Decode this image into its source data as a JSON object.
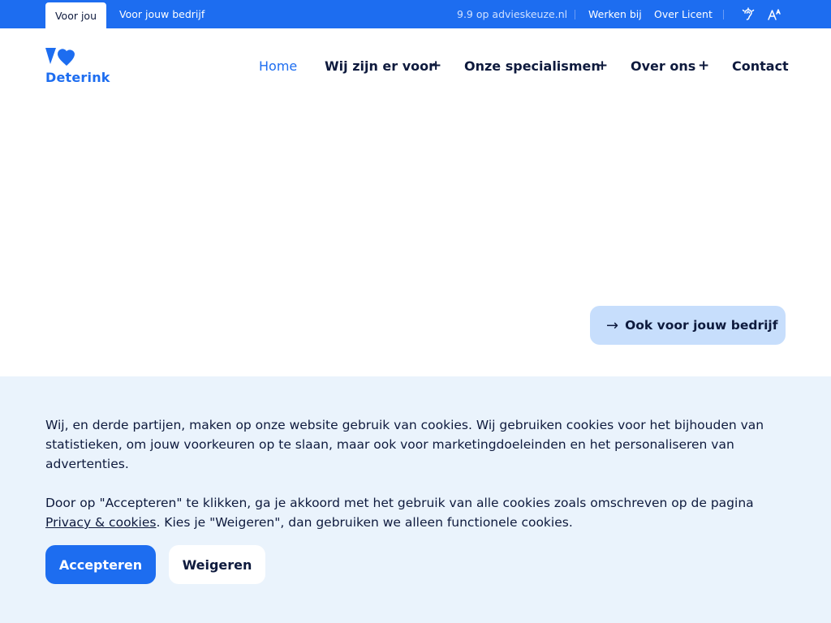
{
  "topbar": {
    "tab_active": "Voor jou",
    "tab_business": "Voor jouw bedrijf",
    "rating": "9.9 op advieskeuze.nl",
    "careers": "Werken bij",
    "licent": "Over Licent",
    "icons": [
      "hearing-icon",
      "text-size-icon"
    ]
  },
  "logo": {
    "text": "Deterink"
  },
  "nav": {
    "home": "Home",
    "we_are_there": "Wij zijn er voor",
    "specialisms": "Onze specialismen",
    "about": "Over ons",
    "contact": "Contact",
    "plus": "+"
  },
  "cta": {
    "arrow": "→",
    "label": "Ook voor jouw bedrijf"
  },
  "cookie": {
    "text1": "Wij, en derde partijen, maken op onze website gebruik van cookies. Wij gebruiken cookies voor het bijhouden van statistieken, om jouw voorkeuren op te slaan, maar ook voor marketingdoeleinden en het personaliseren van advertenties.",
    "text2_before": "Door op \"Accepteren\" te klikken, ga je akkoord met het gebruik van alle cookies zoals omschreven op de pagina ",
    "privacy_link": "Privacy & cookies",
    "text2_after": ". Kies je \"Weigeren\", dan gebruiken we alleen functionele cookies.",
    "accept": "Accepteren",
    "decline": "Weigeren"
  },
  "colors": {
    "brand_blue": "#1d6df0",
    "navy": "#0e1a3d",
    "cta_bg": "#c7defc",
    "cookie_bg": "#eaf3fc"
  }
}
